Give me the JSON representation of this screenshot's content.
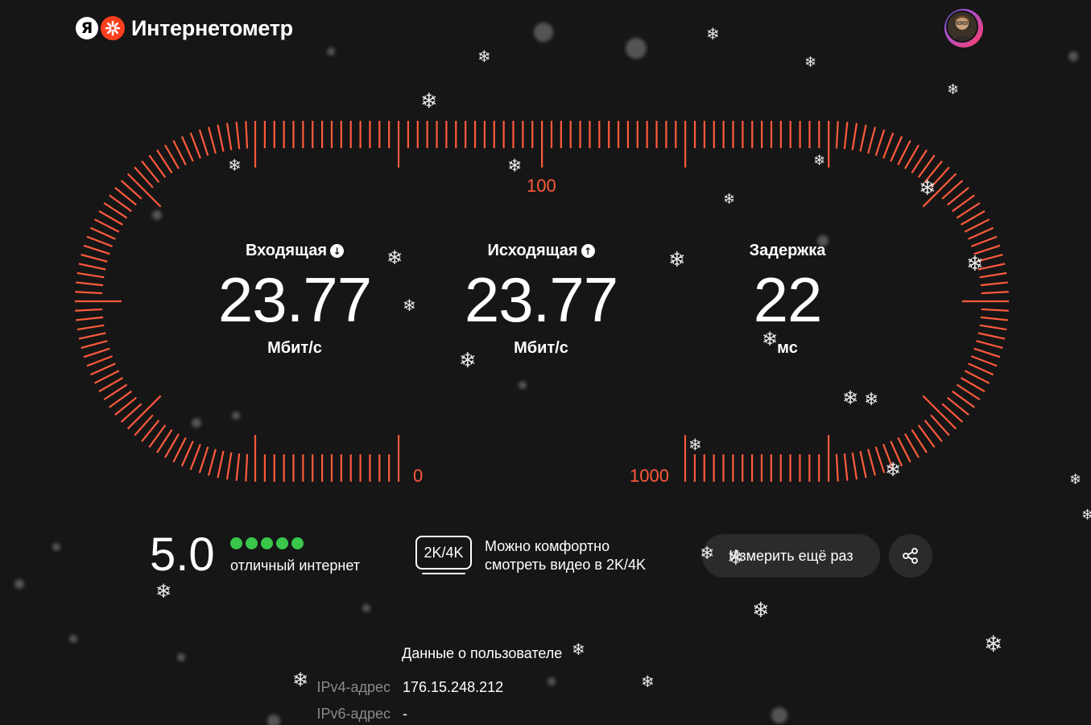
{
  "header": {
    "logo_letter": "Я",
    "title": "Интернетометр"
  },
  "gauge": {
    "label_top": "100",
    "label_left": "0",
    "label_right": "1000",
    "tick_color": "#ff5a3c"
  },
  "metrics": {
    "download": {
      "title": "Входящая",
      "value": "23.77",
      "unit": "Мбит/с"
    },
    "upload": {
      "title": "Исходящая",
      "value": "23.77",
      "unit": "Мбит/с"
    },
    "ping": {
      "title": "Задержка",
      "value": "22",
      "unit": "мс"
    }
  },
  "rating": {
    "score": "5.0",
    "stars": 5,
    "label": "отличный интернет"
  },
  "video": {
    "badge": "2K/4K",
    "line1": "Можно комфортно",
    "line2": "смотреть видео в 2K/4K"
  },
  "actions": {
    "retest_label": "Измерить ещё раз",
    "share_icon": "share-icon"
  },
  "user_info": {
    "heading": "Данные о пользователе",
    "ipv4_label": "IPv4-адрес",
    "ipv4_value": "176.15.248.212",
    "ipv6_label": "IPv6-адрес",
    "ipv6_value": "-"
  },
  "colors": {
    "background": "#161616",
    "accent": "#ff5a3c",
    "brand_red": "#fc3f1d",
    "rating_green": "#3ac64a",
    "button_bg": "#2b2b2b"
  }
}
